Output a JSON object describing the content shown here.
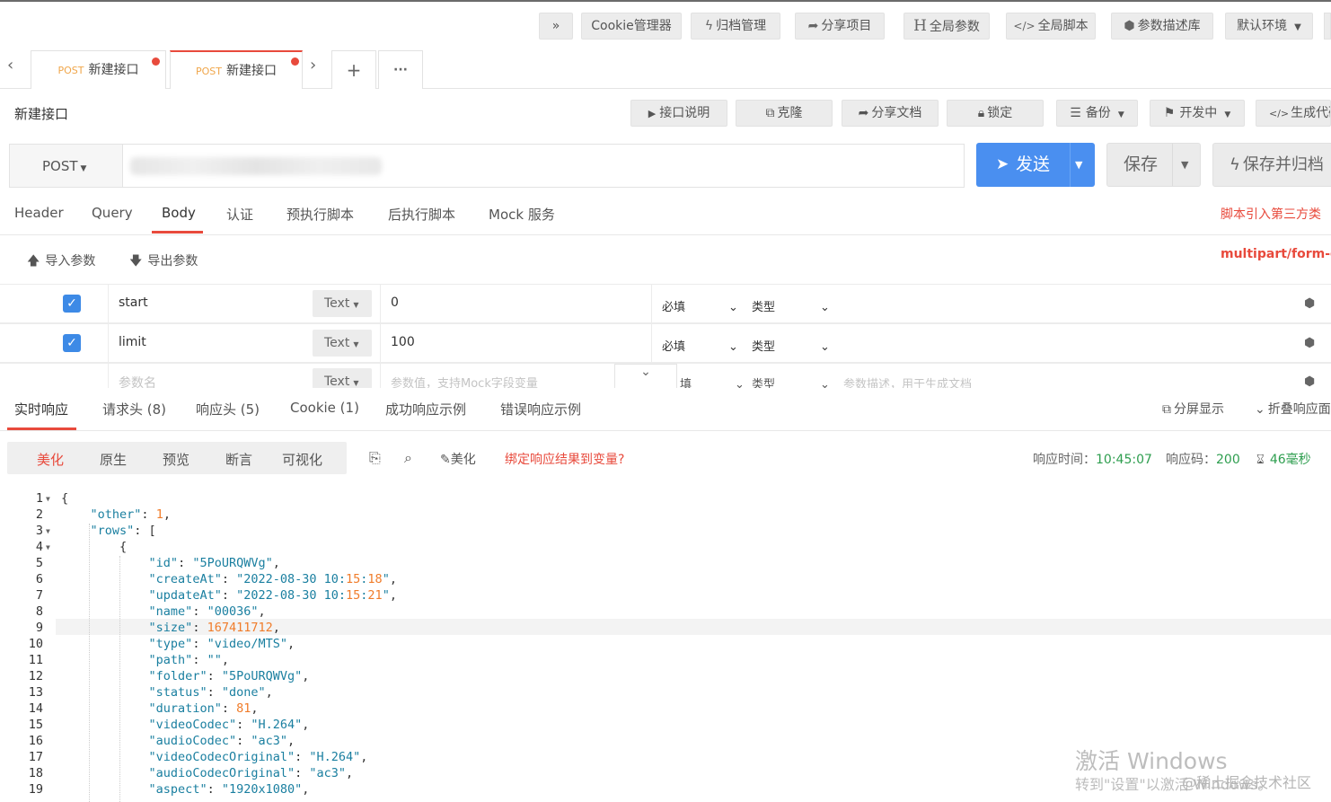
{
  "toolbar": {
    "more_label": "»",
    "cookie_manager": "Cookie管理器",
    "archive_manage": "归档管理",
    "share_project": "分享项目",
    "global_params": "全局参数",
    "global_scripts": "全局脚本",
    "param_library": "参数描述库",
    "default_env": "默认环境"
  },
  "tabs": [
    {
      "method": "POST",
      "label": "新建接口"
    },
    {
      "method": "POST",
      "label": "新建接口"
    }
  ],
  "tabs_nav": {
    "prev": "‹",
    "next": "›",
    "add": "+",
    "more": "···"
  },
  "page_title": "新建接口",
  "actions": {
    "doc": "接口说明",
    "clone": "克隆",
    "share_doc": "分享文档",
    "lock": "锁定",
    "backup": "备份",
    "status": "开发中",
    "gen_code": "生成代码"
  },
  "request": {
    "method": "POST",
    "send": "发送",
    "save": "保存",
    "save_archive": "保存并归档"
  },
  "req_tabs": [
    "Header",
    "Query",
    "Body",
    "认证",
    "预执行脚本",
    "后执行脚本",
    "Mock 服务"
  ],
  "req_tab_hint": "脚本引入第三方类",
  "body_tools": {
    "import": "导入参数",
    "export": "导出参数",
    "content_type": "multipart/form-data"
  },
  "params": [
    {
      "name": "start",
      "type": "Text",
      "value": "0",
      "required": "必填",
      "kind": "类型"
    },
    {
      "name": "limit",
      "type": "Text",
      "value": "100",
      "required": "必填",
      "kind": "类型"
    }
  ],
  "param_placeholder": {
    "name": "参数名",
    "type": "Text",
    "value": "参数值，支持Mock字段变量",
    "required": "填",
    "kind": "类型",
    "desc": "参数描述，用于生成文档"
  },
  "resp_tabs": [
    "实时响应",
    "请求头 (8)",
    "响应头 (5)",
    "Cookie (1)",
    "成功响应示例",
    "错误响应示例"
  ],
  "resp_right": {
    "split": "分屏显示",
    "collapse": "折叠响应面"
  },
  "view_modes": [
    "美化",
    "原生",
    "预览",
    "断言",
    "可视化"
  ],
  "resp_tools": {
    "beautify": "美化",
    "bind_var": "绑定响应结果到变量?"
  },
  "resp_meta": {
    "time_label": "响应时间：",
    "time": "10:45:07",
    "code_label": "响应码：",
    "code": "200",
    "duration": "46毫秒"
  },
  "code_lines": [
    {
      "n": "1",
      "t": "{"
    },
    {
      "n": "2",
      "t": "    \"other\": 1,"
    },
    {
      "n": "3",
      "t": "    \"rows\": ["
    },
    {
      "n": "4",
      "t": "        {"
    },
    {
      "n": "5",
      "t": "            \"id\": \"5PoURQWVg\","
    },
    {
      "n": "6",
      "t": "            \"createAt\": \"2022-08-30 10:15:18\","
    },
    {
      "n": "7",
      "t": "            \"updateAt\": \"2022-08-30 10:15:21\","
    },
    {
      "n": "8",
      "t": "            \"name\": \"00036\","
    },
    {
      "n": "9",
      "t": "            \"size\": 167411712,"
    },
    {
      "n": "10",
      "t": "            \"type\": \"video/MTS\","
    },
    {
      "n": "11",
      "t": "            \"path\": \"\","
    },
    {
      "n": "12",
      "t": "            \"folder\": \"5PoURQWVg\","
    },
    {
      "n": "13",
      "t": "            \"status\": \"done\","
    },
    {
      "n": "14",
      "t": "            \"duration\": 81,"
    },
    {
      "n": "15",
      "t": "            \"videoCodec\": \"H.264\","
    },
    {
      "n": "16",
      "t": "            \"audioCodec\": \"ac3\","
    },
    {
      "n": "17",
      "t": "            \"videoCodecOriginal\": \"H.264\","
    },
    {
      "n": "18",
      "t": "            \"audioCodecOriginal\": \"ac3\","
    },
    {
      "n": "19",
      "t": "            \"aspect\": \"1920x1080\","
    }
  ],
  "watermark": {
    "line1": "激活 Windows",
    "line2": "转到\"设置\"以激活 Windows。",
    "credit": "@稀土掘金技术社区"
  },
  "colors": {
    "accent": "#e84a3c",
    "primary": "#4a8ff0",
    "success": "#2e9e4f",
    "json_key": "#1a7fa0",
    "json_number": "#f07c2a"
  }
}
